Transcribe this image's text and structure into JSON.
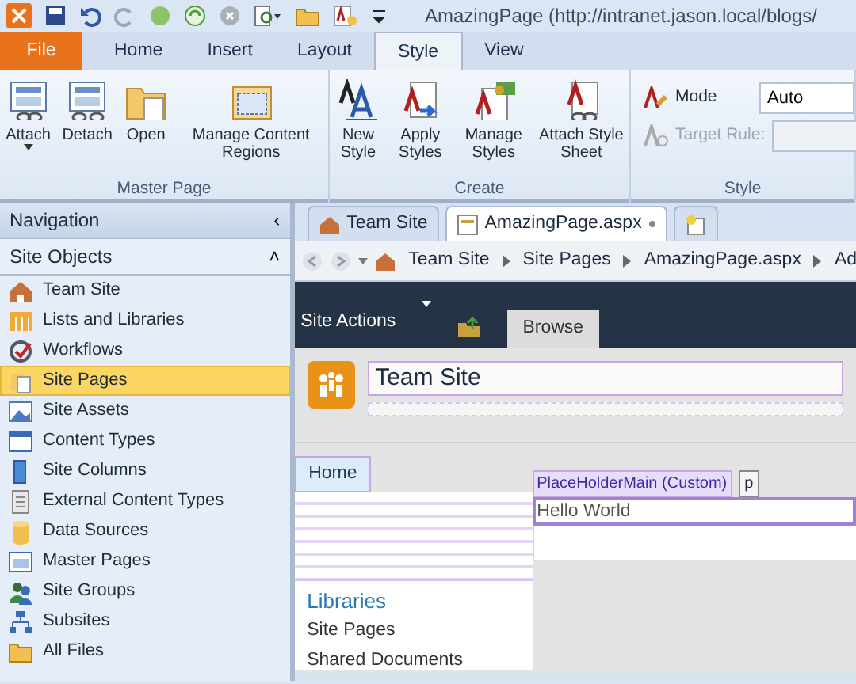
{
  "window": {
    "title": "AmazingPage (http://intranet.jason.local/blogs/"
  },
  "ribbon_tabs": [
    {
      "label": "File",
      "kind": "file",
      "selected": false
    },
    {
      "label": "Home",
      "kind": "tab",
      "selected": false
    },
    {
      "label": "Insert",
      "kind": "tab",
      "selected": false
    },
    {
      "label": "Layout",
      "kind": "tab",
      "selected": false
    },
    {
      "label": "Style",
      "kind": "tab",
      "selected": true
    },
    {
      "label": "View",
      "kind": "tab",
      "selected": false
    }
  ],
  "ribbon_groups": [
    {
      "label": "Master Page",
      "buttons": [
        {
          "label": "Attach",
          "dropdown": true
        },
        {
          "label": "Detach",
          "dropdown": false
        },
        {
          "label": "Open",
          "dropdown": false
        },
        {
          "label": "Manage Content Regions",
          "dropdown": false
        }
      ]
    },
    {
      "label": "Create",
      "buttons": [
        {
          "label": "New Style",
          "dropdown": false
        },
        {
          "label": "Apply Styles",
          "dropdown": false
        },
        {
          "label": "Manage Styles",
          "dropdown": false
        },
        {
          "label": "Attach Style Sheet",
          "dropdown": false
        }
      ]
    },
    {
      "label": "Style",
      "fields": [
        {
          "label": "Mode",
          "value": "Auto",
          "disabled": false
        },
        {
          "label": "Target Rule:",
          "disabled": true
        }
      ]
    }
  ],
  "navigation": {
    "title": "Navigation",
    "collapse_glyph": "‹",
    "section": "Site Objects",
    "section_glyph": "˄",
    "items": [
      {
        "label": "Team Site",
        "selected": false
      },
      {
        "label": "Lists and Libraries",
        "selected": false
      },
      {
        "label": "Workflows",
        "selected": false
      },
      {
        "label": "Site Pages",
        "selected": true
      },
      {
        "label": "Site Assets",
        "selected": false
      },
      {
        "label": "Content Types",
        "selected": false
      },
      {
        "label": "Site Columns",
        "selected": false
      },
      {
        "label": "External Content Types",
        "selected": false
      },
      {
        "label": "Data Sources",
        "selected": false
      },
      {
        "label": "Master Pages",
        "selected": false
      },
      {
        "label": "Site Groups",
        "selected": false
      },
      {
        "label": "Subsites",
        "selected": false
      },
      {
        "label": "All Files",
        "selected": false
      }
    ]
  },
  "document_tabs": [
    {
      "label": "Team Site",
      "selected": false
    },
    {
      "label": "AmazingPage.aspx",
      "modified": true,
      "selected": true
    }
  ],
  "breadcrumb": [
    "Team Site",
    "Site Pages",
    "AmazingPage.aspx",
    "Ad"
  ],
  "page": {
    "site_actions": "Site Actions",
    "ribbon_tab": "Browse",
    "site_title": "Team Site",
    "top_nav": [
      "Home"
    ],
    "placeholder_tag": "PlaceHolderMain (Custom)",
    "element_tag": "p",
    "content": "Hello World",
    "quicklaunch_heading": "Libraries",
    "quicklaunch_items": [
      "Site Pages",
      "Shared Documents"
    ]
  }
}
